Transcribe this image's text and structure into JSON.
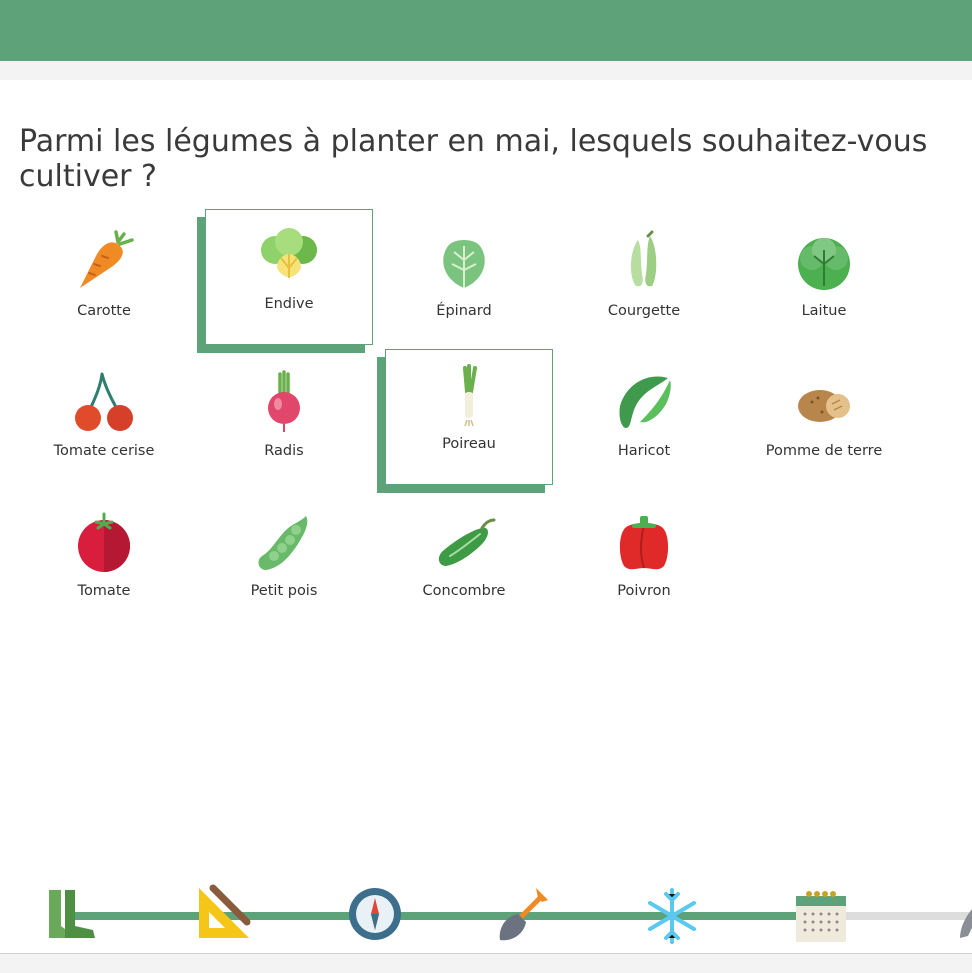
{
  "question": "Parmi les légumes à planter en mai, lesquels souhaitez-vous cultiver ?",
  "vegetables": [
    {
      "label": "Carotte",
      "icon": "carrot-icon",
      "selected": false
    },
    {
      "label": "Endive",
      "icon": "endive-icon",
      "selected": true
    },
    {
      "label": "Épinard",
      "icon": "spinach-icon",
      "selected": false
    },
    {
      "label": "Courgette",
      "icon": "zucchini-icon",
      "selected": false
    },
    {
      "label": "Laitue",
      "icon": "lettuce-icon",
      "selected": false
    },
    {
      "label": "Tomate cerise",
      "icon": "cherry-tomato-icon",
      "selected": false
    },
    {
      "label": "Radis",
      "icon": "radish-icon",
      "selected": false
    },
    {
      "label": "Poireau",
      "icon": "leek-icon",
      "selected": true
    },
    {
      "label": "Haricot",
      "icon": "bean-icon",
      "selected": false
    },
    {
      "label": "Pomme de terre",
      "icon": "potato-icon",
      "selected": false
    },
    {
      "label": "Tomate",
      "icon": "tomato-icon",
      "selected": false
    },
    {
      "label": "Petit pois",
      "icon": "pea-icon",
      "selected": false
    },
    {
      "label": "Concombre",
      "icon": "cucumber-icon",
      "selected": false
    },
    {
      "label": "Poivron",
      "icon": "bell-pepper-icon",
      "selected": false
    }
  ],
  "progress_steps": [
    {
      "icon": "boots-icon",
      "done": true
    },
    {
      "icon": "ruler-pencil-icon",
      "done": true
    },
    {
      "icon": "compass-icon",
      "done": true
    },
    {
      "icon": "shovel-icon",
      "done": true
    },
    {
      "icon": "snowflake-icon",
      "done": true
    },
    {
      "icon": "calendar-icon",
      "done": true
    },
    {
      "icon": "trowel-icon",
      "done": false
    }
  ],
  "colors": {
    "brand_green": "#5ea27a",
    "line_inactive": "#dddddd"
  }
}
